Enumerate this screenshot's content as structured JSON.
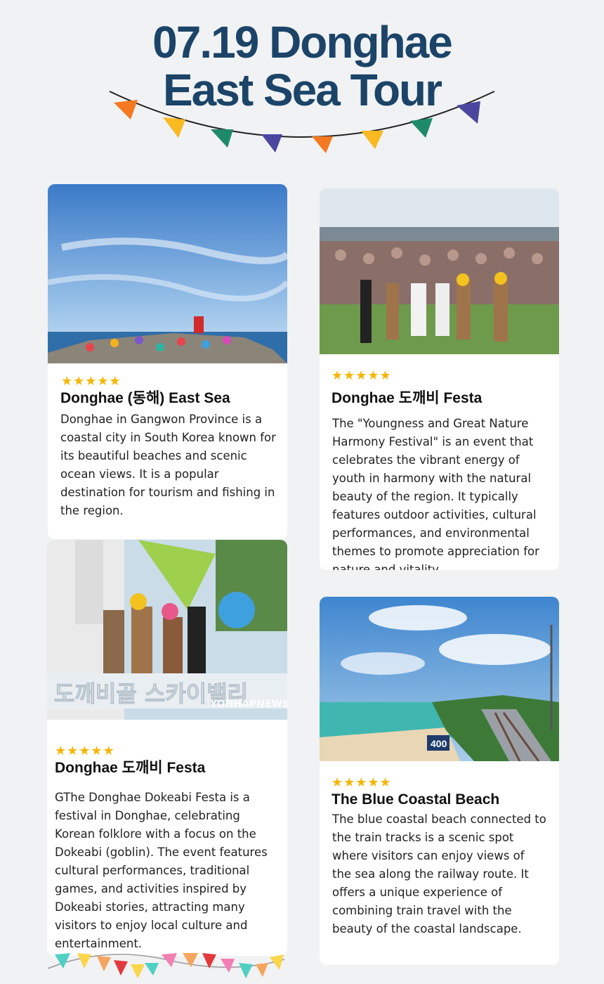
{
  "header": {
    "title_line1": "07.19  Donghae",
    "title_line2": "East Sea Tour"
  },
  "colors": {
    "title": "#1b4468",
    "star": "#f7b500",
    "flag_orange": "#f47920",
    "flag_yellow": "#f9b921",
    "flag_green": "#1e8a6a",
    "flag_purple": "#4b46a0"
  },
  "cards": [
    {
      "rating": "★★★★★",
      "title": "Donghae (동해) East Sea",
      "description": "Donghae in Gangwon Province is a coastal city in South Korea known for its beautiful beaches and scenic ocean views. It is a popular destination for tourism and fishing in the region."
    },
    {
      "rating": "★★★★★",
      "title": "Donghae 도깨비 Festa",
      "description": " The \"Youngness and Great Nature Harmony Festival\" is an event that celebrates the vibrant energy of youth in harmony with the natural beauty of the region. It typically features outdoor activities, cultural performances, and environmental themes to promote appreciation for nature and vitality."
    },
    {
      "rating": "★★★★★",
      "title": "Donghae 도깨비 Festa",
      "description": "GThe Donghae Dokeabi Festa is a festival in Donghae, celebrating Korean folklore with a focus on the Dokeabi (goblin). The event features cultural performances, traditional games, and activities inspired by Dokeabi stories, attracting many visitors to enjoy local culture and entertainment."
    },
    {
      "rating": "★★★★★",
      "title": "The Blue Coastal Beach",
      "description": "The blue coastal beach connected to the train tracks is a scenic spot where visitors can enjoy views of the sea along the railway route. It offers a unique experience of combining train travel with the beauty of the coastal landscape."
    }
  ],
  "photo_labels": {
    "watermark": "YONHAPNEWS",
    "track_sign": "400"
  }
}
